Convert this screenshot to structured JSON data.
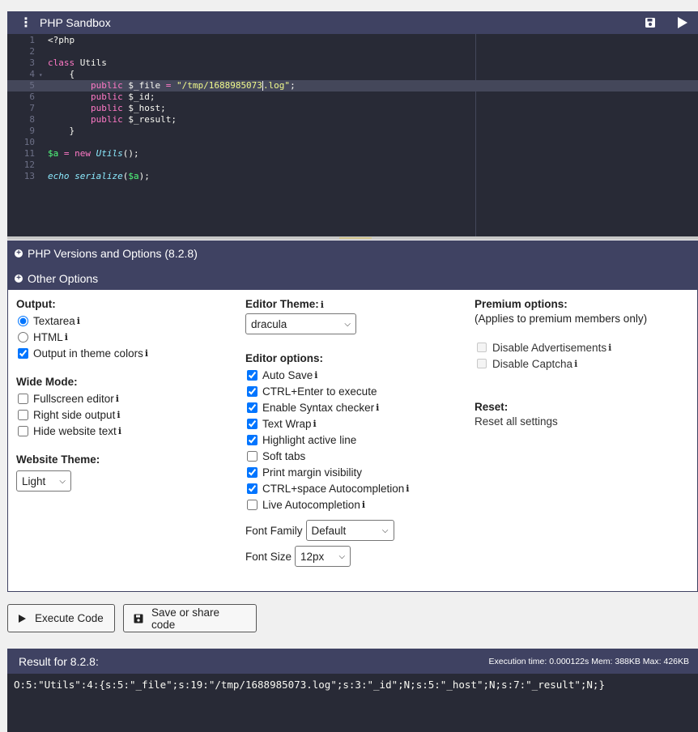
{
  "app": {
    "title": "PHP Sandbox"
  },
  "editor": {
    "lines": [
      {
        "n": "1",
        "tokens": [
          {
            "t": "<?php",
            "c": "p"
          }
        ]
      },
      {
        "n": "2",
        "tokens": []
      },
      {
        "n": "3",
        "tokens": [
          {
            "t": "class ",
            "c": "k"
          },
          {
            "t": "Utils",
            "c": "v"
          }
        ]
      },
      {
        "n": "4",
        "fold": true,
        "tokens": [
          {
            "t": "    {",
            "c": "p"
          }
        ]
      },
      {
        "n": "5",
        "tokens": [
          {
            "t": "        public ",
            "c": "k"
          },
          {
            "t": "$_file",
            "c": "v"
          },
          {
            "t": " = ",
            "c": "k"
          },
          {
            "t": "\"/tmp/1688985073",
            "c": "s"
          },
          {
            "t": "|",
            "c": "cursor"
          },
          {
            "t": ".log\"",
            "c": "s"
          },
          {
            "t": ";",
            "c": "p"
          }
        ]
      },
      {
        "n": "6",
        "tokens": [
          {
            "t": "        public ",
            "c": "k"
          },
          {
            "t": "$_id",
            "c": "v"
          },
          {
            "t": ";",
            "c": "p"
          }
        ]
      },
      {
        "n": "7",
        "tokens": [
          {
            "t": "        public ",
            "c": "k"
          },
          {
            "t": "$_host",
            "c": "v"
          },
          {
            "t": ";",
            "c": "p"
          }
        ]
      },
      {
        "n": "8",
        "tokens": [
          {
            "t": "        public ",
            "c": "k"
          },
          {
            "t": "$_result",
            "c": "v"
          },
          {
            "t": ";",
            "c": "p"
          }
        ]
      },
      {
        "n": "9",
        "tokens": [
          {
            "t": "    }",
            "c": "p"
          }
        ]
      },
      {
        "n": "10",
        "tokens": []
      },
      {
        "n": "11",
        "tokens": [
          {
            "t": "$a",
            "c": "f"
          },
          {
            "t": " = ",
            "c": "k"
          },
          {
            "t": "new ",
            "c": "k"
          },
          {
            "t": "Utils",
            "c": "c"
          },
          {
            "t": "();",
            "c": "p"
          }
        ]
      },
      {
        "n": "12",
        "tokens": []
      },
      {
        "n": "13",
        "tokens": [
          {
            "t": "echo ",
            "c": "c"
          },
          {
            "t": "serialize",
            "c": "c"
          },
          {
            "t": "(",
            "c": "p"
          },
          {
            "t": "$a",
            "c": "f"
          },
          {
            "t": ");",
            "c": "p"
          }
        ]
      }
    ]
  },
  "sections": {
    "php_versions": "PHP Versions and Options (8.2.8)",
    "other_options": "Other Options"
  },
  "output": {
    "heading": "Output:",
    "options": [
      {
        "label": "Textarea",
        "type": "radio",
        "checked": true,
        "info": true
      },
      {
        "label": "HTML",
        "type": "radio",
        "checked": false,
        "info": true
      },
      {
        "label": "Output in theme colors",
        "type": "checkbox",
        "checked": true,
        "info": true
      }
    ]
  },
  "wide_mode": {
    "heading": "Wide Mode:",
    "options": [
      {
        "label": "Fullscreen editor",
        "checked": false,
        "info": true
      },
      {
        "label": "Right side output",
        "checked": false,
        "info": true
      },
      {
        "label": "Hide website text",
        "checked": false,
        "info": true
      }
    ]
  },
  "website_theme": {
    "heading": "Website Theme:",
    "value": "Light"
  },
  "editor_theme": {
    "heading": "Editor Theme:",
    "value": "dracula"
  },
  "editor_options": {
    "heading": "Editor options:",
    "options": [
      {
        "label": "Auto Save",
        "checked": true,
        "info": true
      },
      {
        "label": "CTRL+Enter to execute",
        "checked": true,
        "info": false
      },
      {
        "label": "Enable Syntax checker",
        "checked": true,
        "info": true
      },
      {
        "label": "Text Wrap",
        "checked": true,
        "info": true
      },
      {
        "label": "Highlight active line",
        "checked": true,
        "info": false
      },
      {
        "label": "Soft tabs",
        "checked": false,
        "info": false
      },
      {
        "label": "Print margin visibility",
        "checked": true,
        "info": false
      },
      {
        "label": "CTRL+space Autocompletion",
        "checked": true,
        "info": true
      },
      {
        "label": "Live Autocompletion",
        "checked": false,
        "info": true
      }
    ],
    "font_family_label": "Font Family",
    "font_family_value": "Default",
    "font_size_label": "Font Size",
    "font_size_value": "12px"
  },
  "premium": {
    "heading": "Premium options:",
    "note": "(Applies to premium members only)",
    "options": [
      {
        "label": "Disable Advertisements",
        "info": true
      },
      {
        "label": "Disable Captcha",
        "info": true
      }
    ]
  },
  "reset": {
    "heading": "Reset:",
    "link": "Reset all settings"
  },
  "buttons": {
    "execute": "Execute Code",
    "save": "Save or share code"
  },
  "result": {
    "title": "Result for 8.2.8:",
    "meta": "Execution time: 0.000122s Mem: 388KB Max: 426KB",
    "output": "O:5:\"Utils\":4:{s:5:\"_file\";s:19:\"/tmp/1688985073.log\";s:3:\"_id\";N;s:5:\"_host\";N;s:7:\"_result\";N;}"
  },
  "icons": {
    "menu": "kebab-menu-icon",
    "save": "floppy-disk-icon",
    "run": "play-icon",
    "expand": "plus-circle-icon",
    "info": "info-icon"
  },
  "colors": {
    "bar": "#3f4262",
    "editor_bg": "#282a36"
  }
}
